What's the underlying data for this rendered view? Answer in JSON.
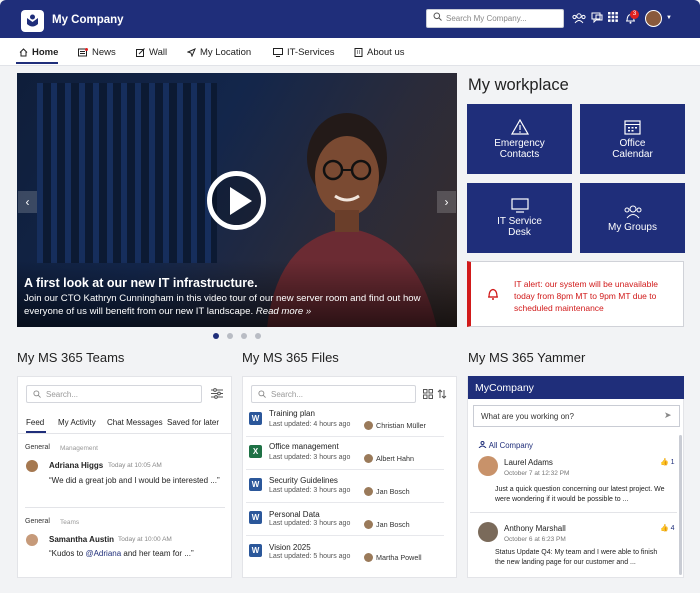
{
  "header": {
    "company": "My Company",
    "search_placeholder": "Search My Company...",
    "notification_count": "3"
  },
  "nav": {
    "items": [
      {
        "label": "Home",
        "icon": "home-icon"
      },
      {
        "label": "News",
        "icon": "news-icon"
      },
      {
        "label": "Wall",
        "icon": "edit-icon"
      },
      {
        "label": "My Location",
        "icon": "location-icon"
      },
      {
        "label": "IT-Services",
        "icon": "monitor-icon"
      },
      {
        "label": "About us",
        "icon": "building-icon"
      }
    ]
  },
  "hero": {
    "title": "A first look at our new IT infrastructure.",
    "text": "Join our CTO Kathryn Cunningham in this video tour of our new server room and find out how everyone of us will benefit from our new IT landscape.",
    "more": "Read more »"
  },
  "workplace": {
    "title": "My workplace",
    "tiles": [
      {
        "label1": "Emergency",
        "label2": "Contacts",
        "icon": "warning-icon"
      },
      {
        "label1": "Office",
        "label2": "Calendar",
        "icon": "calendar-icon"
      },
      {
        "label1": "IT Service",
        "label2": "Desk",
        "icon": "monitor-icon"
      },
      {
        "label1": "My Groups",
        "label2": "",
        "icon": "group-icon"
      }
    ],
    "alert": "IT alert: our system will be unavailable today from 8pm MT to 9pm MT due to scheduled maintenance"
  },
  "teams": {
    "title": "My MS 365 Teams",
    "search_placeholder": "Search...",
    "tabs": [
      "Feed",
      "My Activity",
      "Chat Messages",
      "Saved for later"
    ],
    "posts": [
      {
        "team": "General",
        "channel": "Management",
        "author": "Adriana Higgs",
        "time": "Today at 10:05 AM",
        "text": "“We did a great job and I would be interested ...”"
      },
      {
        "team": "General",
        "channel": "Teams",
        "author": "Samantha Austin",
        "time": "Today at 10:00 AM",
        "text_before": "“Kudos to ",
        "mention": "@Adriana",
        "text_after": " and her team for ...”"
      }
    ]
  },
  "files": {
    "title": "My MS 365 Files",
    "search_placeholder": "Search...",
    "items": [
      {
        "name": "Training plan",
        "meta": "Last updated: 4 hours ago",
        "author": "Christian Müller",
        "type": "W"
      },
      {
        "name": "Office management",
        "meta": "Last updated: 3 hours ago",
        "author": "Albert Hahn",
        "type": "X"
      },
      {
        "name": "Security Guidelines",
        "meta": "Last updated: 3 hours ago",
        "author": "Jan Bosch",
        "type": "W"
      },
      {
        "name": "Personal Data",
        "meta": "Last updated: 3 hours ago",
        "author": "Jan Bosch",
        "type": "W"
      },
      {
        "name": "Vision 2025",
        "meta": "Last updated: 5 hours ago",
        "author": "Martha Powell",
        "type": "W"
      }
    ]
  },
  "yammer": {
    "title": "My MS 365 Yammer",
    "community": "MyCompany",
    "input_placeholder": "What are you working on?",
    "all_company": "All Company",
    "posts": [
      {
        "author": "Laurel Adams",
        "date": "October 7 at 12:32 PM",
        "likes": "1",
        "text": "Just a quick question concerning our latest project. We were wondering if it would be possible to ..."
      },
      {
        "author": "Anthony Marshall",
        "date": "October 6 at 6:23 PM",
        "likes": "4",
        "text": "Status Update Q4: My team and I were able to finish the new landing page for our customer and ..."
      }
    ]
  },
  "colors": {
    "brand": "#1f2e7a",
    "alert": "#d11a1a"
  }
}
